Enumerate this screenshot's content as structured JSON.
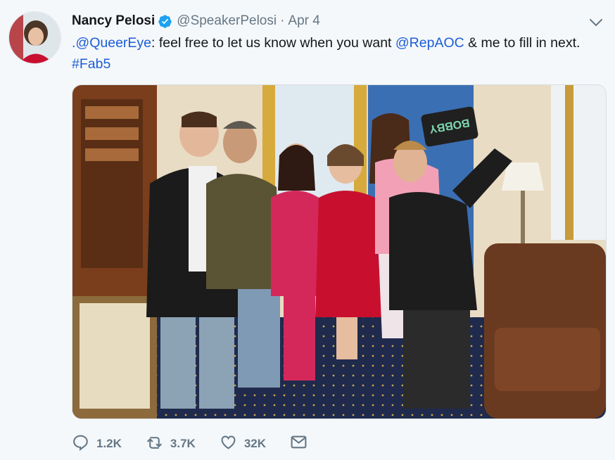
{
  "tweet": {
    "author_name": "Nancy Pelosi",
    "handle": "@SpeakerPelosi",
    "separator": "·",
    "date": "Apr 4",
    "text_parts": [
      {
        "type": "mention",
        "text": ".@QueerEye"
      },
      {
        "type": "text",
        "text": ": feel free to let us know when you want "
      },
      {
        "type": "mention",
        "text": "@RepAOC"
      },
      {
        "type": "text",
        "text": " & me to fill in next. "
      },
      {
        "type": "hashtag",
        "text": "#Fab5"
      }
    ],
    "phone_case_text": "BOBBY"
  },
  "actions": {
    "replies": "1.2K",
    "retweets": "3.7K",
    "likes": "32K"
  },
  "colors": {
    "link": "#1b5dd6",
    "verified": "#1da1f2",
    "muted": "#657786",
    "background": "#f5f8fa"
  },
  "icons": [
    "verified-badge-icon",
    "chevron-down-icon",
    "reply-icon",
    "retweet-icon",
    "like-icon",
    "direct-message-icon"
  ]
}
